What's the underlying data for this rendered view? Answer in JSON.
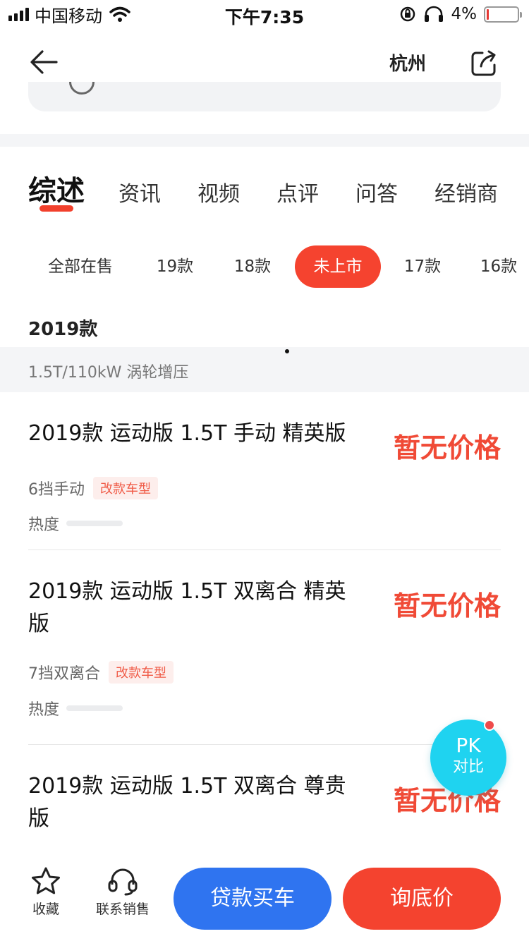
{
  "status_bar": {
    "carrier": "中国移动",
    "time": "下午7:35",
    "battery_pct": "4%",
    "battery_level": 0.04
  },
  "nav": {
    "back_icon": "arrow-left-icon",
    "city": "杭州",
    "share_icon": "share-icon"
  },
  "tabs": [
    {
      "label": "综述",
      "active": true
    },
    {
      "label": "资讯"
    },
    {
      "label": "视频"
    },
    {
      "label": "点评"
    },
    {
      "label": "问答"
    },
    {
      "label": "经销商"
    }
  ],
  "year_filters": [
    {
      "label": "全部在售"
    },
    {
      "label": "19款"
    },
    {
      "label": "18款"
    },
    {
      "label": "未上市",
      "active": true
    },
    {
      "label": "17款"
    },
    {
      "label": "16款"
    }
  ],
  "section": {
    "year_title": "2019款",
    "engine": "1.5T/110kW 涡轮增压"
  },
  "cars": [
    {
      "name": "2019款 运动版 1.5T 手动 精英版",
      "price": "暂无价格",
      "transmission": "6挡手动",
      "tag": "改款车型",
      "heat_label": "热度",
      "heat": 0
    },
    {
      "name": "2019款 运动版 1.5T 双离合 精英版",
      "price": "暂无价格",
      "transmission": "7挡双离合",
      "tag": "改款车型",
      "heat_label": "热度",
      "heat": 0
    },
    {
      "name": "2019款 运动版 1.5T 双离合 尊贵版",
      "price": "暂无价格"
    }
  ],
  "pk": {
    "top": "PK",
    "bottom": "对比"
  },
  "bottom_bar": {
    "favorite_label": "收藏",
    "favorite_icon": "star-icon",
    "contact_label": "联系销售",
    "contact_icon": "headset-icon",
    "loan_label": "贷款买车",
    "price_label": "询底价"
  },
  "colors": {
    "accent_red": "#f5432f",
    "price_red": "#f04a36",
    "loan_blue": "#2f74f0",
    "pk_cyan": "#1fd3f0"
  }
}
